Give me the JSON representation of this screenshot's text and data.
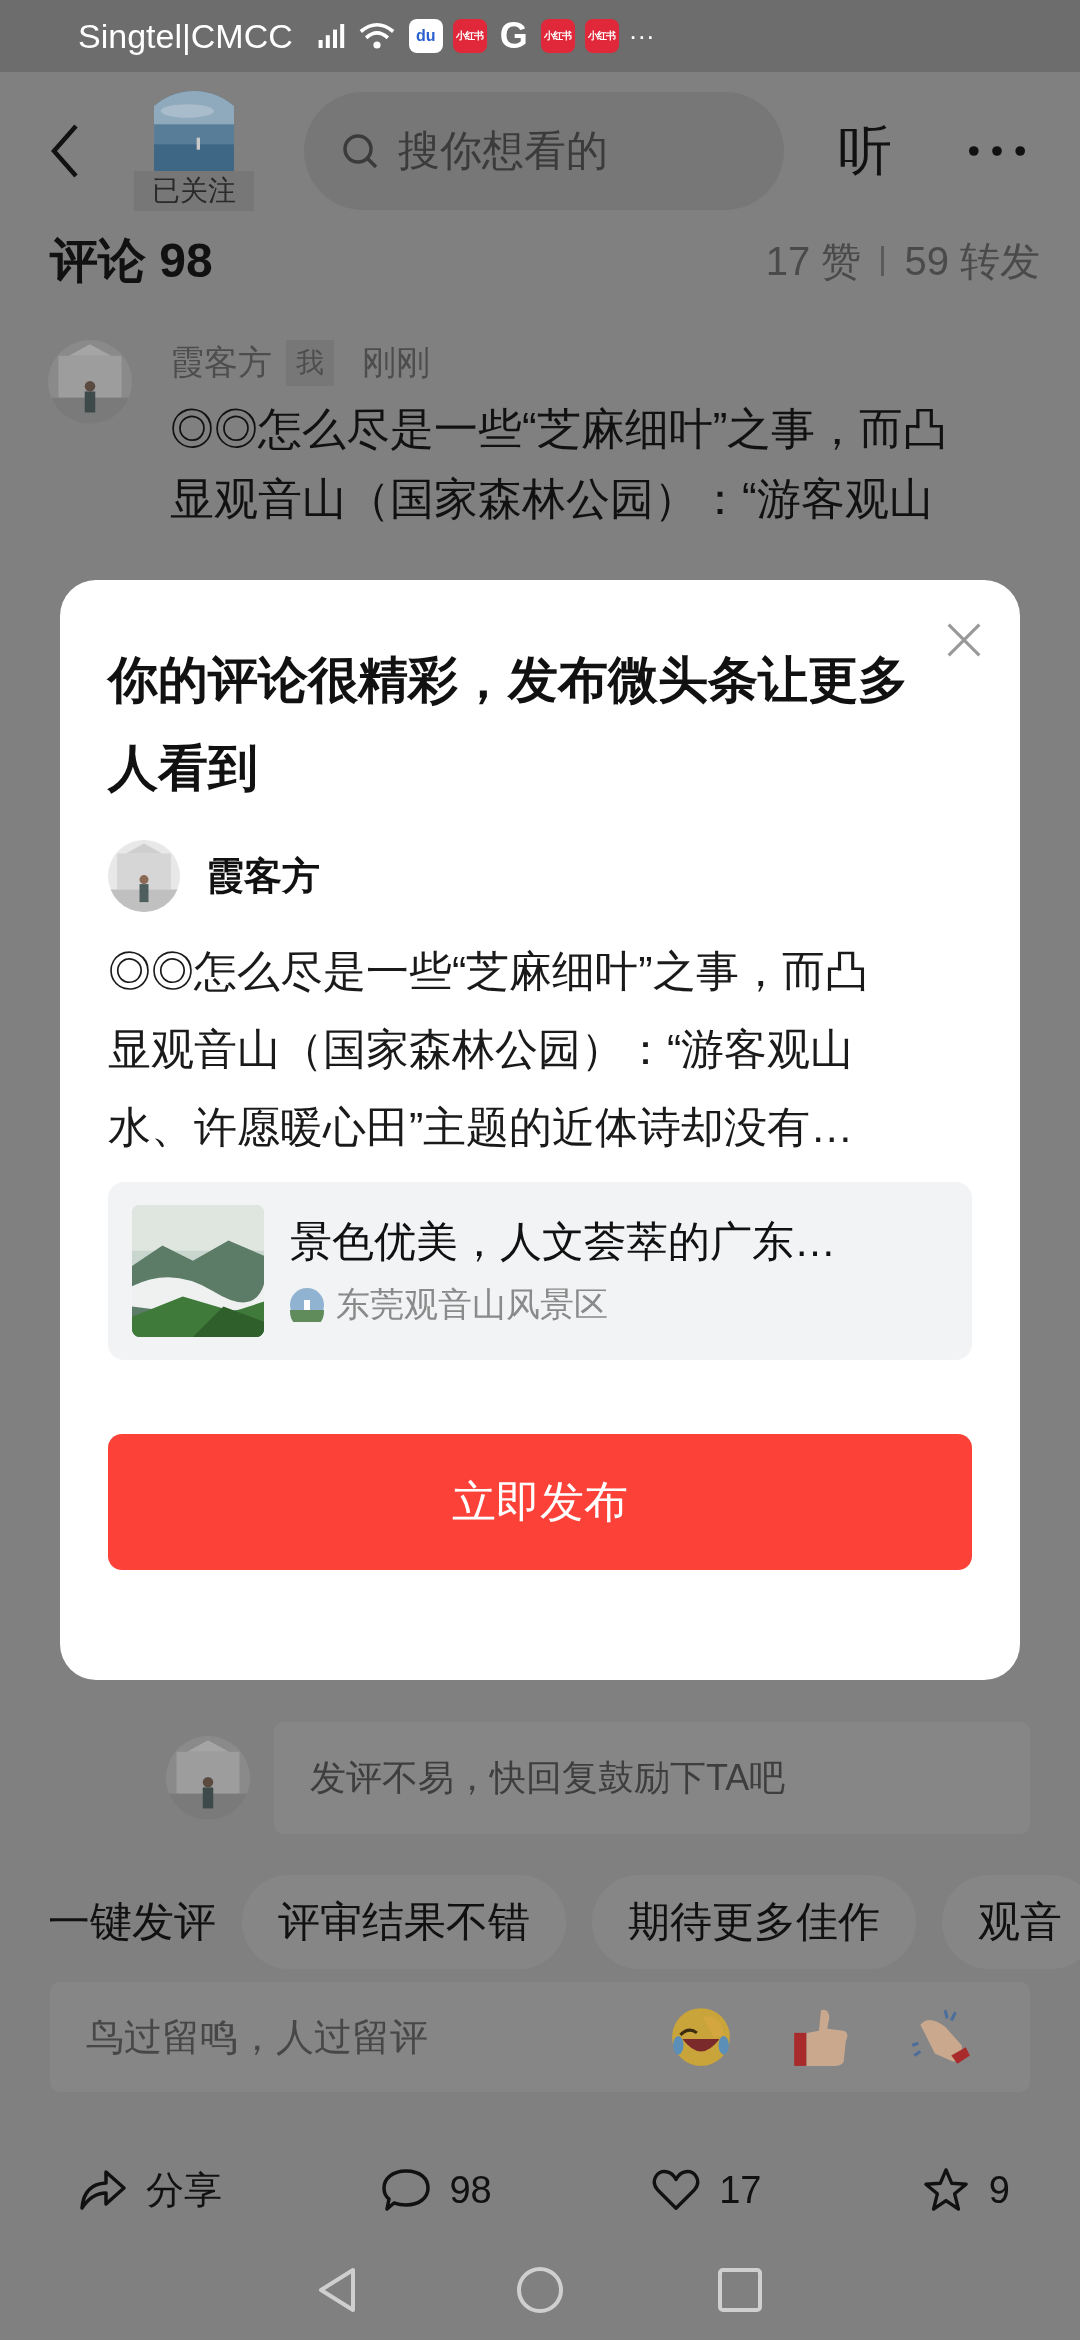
{
  "status_bar": {
    "carrier": "Singtel|CMCC",
    "notification_icons": [
      {
        "kind": "baidu",
        "label": "du"
      },
      {
        "kind": "xhs",
        "label": "小红书"
      },
      {
        "kind": "google",
        "label": "G"
      },
      {
        "kind": "xhs",
        "label": "小红书"
      },
      {
        "kind": "xhs",
        "label": "小红书"
      }
    ],
    "more": "···"
  },
  "header": {
    "follow_label": "已关注",
    "search_placeholder": "搜你想看的",
    "listen": "听"
  },
  "comments_header": {
    "title": "评论 98",
    "likes": "17 赞",
    "reposts": "59 转发"
  },
  "comment": {
    "author": "霞客方",
    "tag": "我",
    "time": "刚刚",
    "lines": [
      "◎◎怎么尽是一些“芝麻细叶”之事，而凸",
      "显观音山（国家森林公园）：“游客观山"
    ]
  },
  "dialog": {
    "title_lines": [
      "你的评论很精彩，发布微头条让更多",
      "人看到"
    ],
    "author": "霞客方",
    "text_lines": [
      "◎◎怎么尽是一些“芝麻细叶”之事，而凸",
      "显观音山（国家森林公园）：“游客观山",
      "水、许愿暖心田”主题的近体诗却没有…"
    ],
    "link": {
      "title": "景色优美，人文荟萃的广东…",
      "source": "东莞观音山风景区"
    },
    "button": "立即发布"
  },
  "reply_prompt": {
    "placeholder": "发评不易，快回复鼓励下TA吧"
  },
  "quick_replies": {
    "label": "一键发评",
    "chips": [
      "评审结果不错",
      "期待更多佳作",
      "观音"
    ]
  },
  "comment_input": {
    "placeholder": "鸟过留鸣，人过留评",
    "emojis": [
      {
        "kind": "laugh"
      },
      {
        "kind": "thumbs"
      },
      {
        "kind": "clap"
      }
    ]
  },
  "actions": [
    {
      "kind": "share",
      "label": "分享"
    },
    {
      "kind": "comment",
      "label": "98"
    },
    {
      "kind": "like",
      "label": "17"
    },
    {
      "kind": "favorite",
      "label": "9"
    }
  ]
}
